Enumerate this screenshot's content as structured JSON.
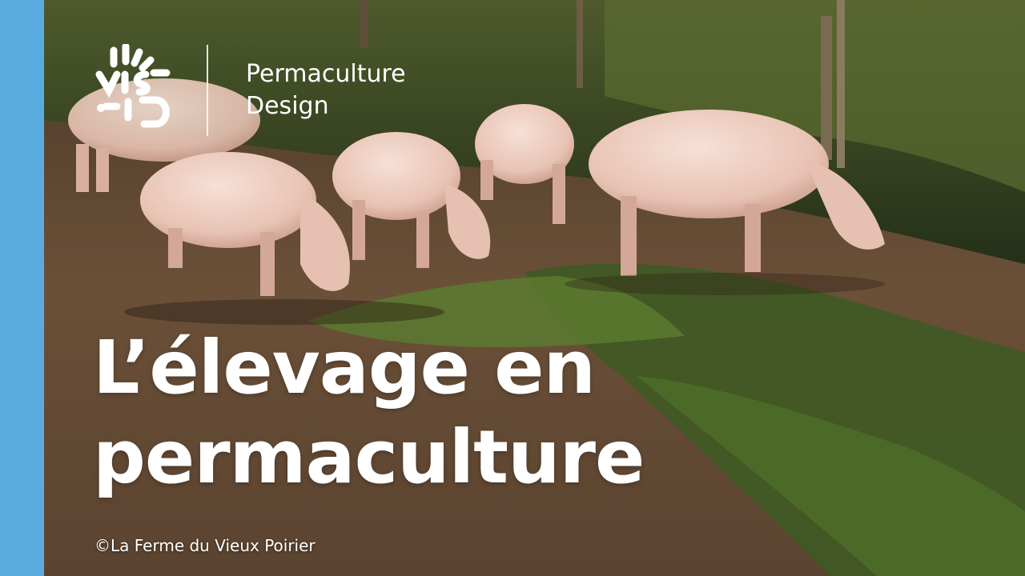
{
  "brand": {
    "logo_icon": "vivre-logo-icon",
    "line1": "Permaculture",
    "line2": "Design"
  },
  "headline": {
    "line1": "L’élevage en",
    "line2": "permaculture"
  },
  "credit": "©La Ferme du Vieux Poirier",
  "colors": {
    "accent_bar": "#5aace0",
    "text": "#ffffff"
  }
}
